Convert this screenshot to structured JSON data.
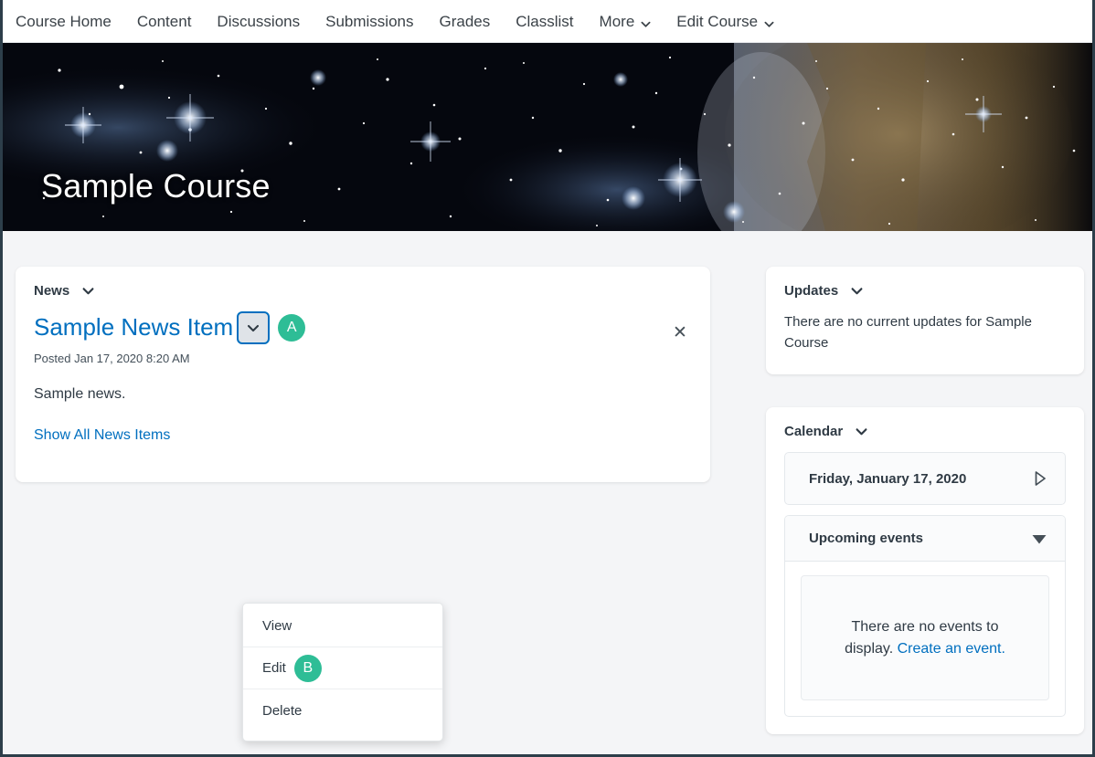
{
  "nav": {
    "items": [
      {
        "label": "Course Home",
        "has_chevron": false,
        "icon": ""
      },
      {
        "label": "Content",
        "has_chevron": false,
        "icon": ""
      },
      {
        "label": "Discussions",
        "has_chevron": false,
        "icon": ""
      },
      {
        "label": "Submissions",
        "has_chevron": false,
        "icon": ""
      },
      {
        "label": "Grades",
        "has_chevron": false,
        "icon": ""
      },
      {
        "label": "Classlist",
        "has_chevron": false,
        "icon": ""
      },
      {
        "label": "More",
        "has_chevron": true,
        "icon": "chevron-down-icon"
      },
      {
        "label": "Edit Course",
        "has_chevron": true,
        "icon": "chevron-down-icon"
      }
    ]
  },
  "banner": {
    "title": "Sample Course",
    "image_description": "star field nebula"
  },
  "news": {
    "widget_title": "News",
    "collapse_icon": "chevron-down-icon",
    "item_title": "Sample News Item",
    "context_menu_icon": "chevron-down-icon",
    "badge_a": "A",
    "close_icon": "close-icon",
    "posted": "Posted Jan 17, 2020 8:20 AM",
    "body": "Sample news.",
    "show_all": "Show All News Items"
  },
  "context_menu": {
    "items": [
      {
        "label": "View",
        "badge": ""
      },
      {
        "label": "Edit",
        "badge": "B"
      },
      {
        "label": "Delete",
        "badge": ""
      }
    ]
  },
  "updates": {
    "widget_title": "Updates",
    "collapse_icon": "chevron-down-icon",
    "message": "There are no current updates for Sample Course"
  },
  "calendar": {
    "widget_title": "Calendar",
    "collapse_icon": "chevron-down-icon",
    "date": "Friday, January 17, 2020",
    "date_next_icon": "triangle-right-icon",
    "upcoming_title": "Upcoming events",
    "upcoming_toggle_icon": "triangle-down-icon",
    "empty_text": "There are no events to display.",
    "empty_link": "Create an event."
  },
  "colors": {
    "accent_link": "#006fbf",
    "badge_green": "#2ebd96",
    "text": "#2f3a44",
    "page_border": "#2d3e4a",
    "background": "#f4f5f7"
  }
}
